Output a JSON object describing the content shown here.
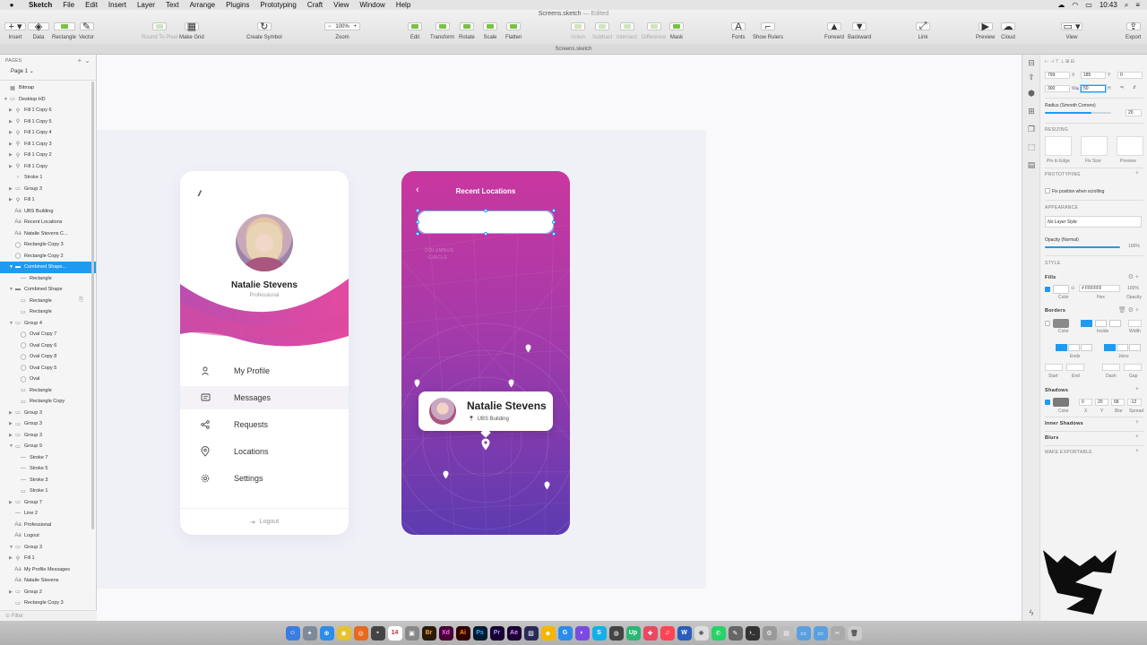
{
  "menubar": {
    "items": [
      "Sketch",
      "File",
      "Edit",
      "Insert",
      "Layer",
      "Text",
      "Arrange",
      "Plugins",
      "Prototyping",
      "Craft",
      "View",
      "Window",
      "Help"
    ],
    "time": "10:43"
  },
  "toolbar": {
    "doc_title": "Screens.sketch",
    "doc_state": "— Edited",
    "zoom_value": "100%",
    "buttons": {
      "insert": "Insert",
      "data": "Data",
      "rectangle": "Rectangle",
      "vector": "Vector",
      "round": "Round To Pixel",
      "make_grid": "Make Grid",
      "create_symbol": "Create Symbol",
      "zoom": "Zoom",
      "edit": "Edit",
      "transform": "Transform",
      "rotate": "Rotate",
      "scale": "Scale",
      "flatten": "Flatten",
      "union": "Union",
      "subtract": "Subtract",
      "intersect": "Intersect",
      "difference": "Difference",
      "mask": "Mask",
      "fonts": "Fonts",
      "show_rulers": "Show Rulers",
      "forward": "Forward",
      "backward": "Backward",
      "link": "Link",
      "preview": "Preview",
      "cloud": "Cloud",
      "view": "View",
      "export": "Export"
    }
  },
  "tab_title": "Screens.sketch",
  "layers": {
    "pages_header": "PAGES",
    "page": "Page 1",
    "filter": "Filter",
    "rows": [
      {
        "label": "Bitmap",
        "indent": 0,
        "icon": "▦",
        "tri": ""
      },
      {
        "label": "Desktop HD",
        "indent": 0,
        "icon": "▭",
        "tri": "▼"
      },
      {
        "label": "Fill 1 Copy 6",
        "indent": 1,
        "icon": "⚲",
        "tri": "▶"
      },
      {
        "label": "Fill 1 Copy 5",
        "indent": 1,
        "icon": "⚲",
        "tri": "▶"
      },
      {
        "label": "Fill 1 Copy 4",
        "indent": 1,
        "icon": "⚲",
        "tri": "▶"
      },
      {
        "label": "Fill 1 Copy 3",
        "indent": 1,
        "icon": "⚲",
        "tri": "▶"
      },
      {
        "label": "Fill 1 Copy 2",
        "indent": 1,
        "icon": "⚲",
        "tri": "▶"
      },
      {
        "label": "Fill 1 Copy",
        "indent": 1,
        "icon": "⚲",
        "tri": "▶"
      },
      {
        "label": "Stroke 1",
        "indent": 1,
        "icon": "‹",
        "tri": ""
      },
      {
        "label": "Group 3",
        "indent": 1,
        "icon": "▭",
        "tri": "▶"
      },
      {
        "label": "Fill 1",
        "indent": 1,
        "icon": "⚲",
        "tri": "▶"
      },
      {
        "label": "UBS Building",
        "indent": 1,
        "icon": "Aa",
        "tri": ""
      },
      {
        "label": "Recent Locations",
        "indent": 1,
        "icon": "Aa",
        "tri": ""
      },
      {
        "label": "Natalie Stevens C...",
        "indent": 1,
        "icon": "Aa",
        "tri": ""
      },
      {
        "label": "Rectangle Copy 3",
        "indent": 1,
        "icon": "◯",
        "tri": ""
      },
      {
        "label": "Rectangle Copy 2",
        "indent": 1,
        "icon": "◯",
        "tri": ""
      },
      {
        "label": "Combined Shape...",
        "indent": 1,
        "icon": "▬",
        "tri": "▼",
        "selected": true
      },
      {
        "label": "Rectangle",
        "indent": 2,
        "icon": "—",
        "tri": ""
      },
      {
        "label": "Combined Shape",
        "indent": 1,
        "icon": "▬",
        "tri": "▼"
      },
      {
        "label": "Rectangle",
        "indent": 2,
        "icon": "▭",
        "tri": "",
        "lock": true
      },
      {
        "label": "Rectangle",
        "indent": 2,
        "icon": "▭",
        "tri": ""
      },
      {
        "label": "Group 4",
        "indent": 1,
        "icon": "▭",
        "tri": "▼"
      },
      {
        "label": "Oval Copy 7",
        "indent": 2,
        "icon": "◯",
        "tri": ""
      },
      {
        "label": "Oval Copy 6",
        "indent": 2,
        "icon": "◯",
        "tri": ""
      },
      {
        "label": "Oval Copy 8",
        "indent": 2,
        "icon": "◯",
        "tri": ""
      },
      {
        "label": "Oval Copy 5",
        "indent": 2,
        "icon": "◯",
        "tri": ""
      },
      {
        "label": "Oval",
        "indent": 2,
        "icon": "◯",
        "tri": ""
      },
      {
        "label": "Rectangle",
        "indent": 2,
        "icon": "▭",
        "tri": ""
      },
      {
        "label": "Rectangle Copy",
        "indent": 2,
        "icon": "▭",
        "tri": ""
      },
      {
        "label": "Group 3",
        "indent": 1,
        "icon": "▭",
        "tri": "▶"
      },
      {
        "label": "Group 3",
        "indent": 1,
        "icon": "▭",
        "tri": "▶"
      },
      {
        "label": "Group 3",
        "indent": 1,
        "icon": "▭",
        "tri": "▶"
      },
      {
        "label": "Group 9",
        "indent": 1,
        "icon": "▭",
        "tri": "▼"
      },
      {
        "label": "Stroke 7",
        "indent": 2,
        "icon": "—",
        "tri": ""
      },
      {
        "label": "Stroke 5",
        "indent": 2,
        "icon": "—",
        "tri": ""
      },
      {
        "label": "Stroke 3",
        "indent": 2,
        "icon": "—",
        "tri": ""
      },
      {
        "label": "Stroke 1",
        "indent": 2,
        "icon": "▭",
        "tri": ""
      },
      {
        "label": "Group 7",
        "indent": 1,
        "icon": "▭",
        "tri": "▶"
      },
      {
        "label": "Line 2",
        "indent": 1,
        "icon": "—",
        "tri": ""
      },
      {
        "label": "Professional",
        "indent": 1,
        "icon": "Aa",
        "tri": ""
      },
      {
        "label": "Logout",
        "indent": 1,
        "icon": "Aa",
        "tri": ""
      },
      {
        "label": "Group 3",
        "indent": 1,
        "icon": "▭",
        "tri": "▼"
      },
      {
        "label": "Fill 1",
        "indent": 1,
        "icon": "⚲",
        "tri": "▶"
      },
      {
        "label": "My Profile Messages",
        "indent": 1,
        "icon": "Aa",
        "tri": ""
      },
      {
        "label": "Natalie Stevens",
        "indent": 1,
        "icon": "Aa",
        "tri": ""
      },
      {
        "label": "Group 2",
        "indent": 1,
        "icon": "▭",
        "tri": "▶"
      },
      {
        "label": "Rectangle Copy 3",
        "indent": 1,
        "icon": "▭",
        "tri": ""
      }
    ]
  },
  "menu_card": {
    "name": "Natalie Stevens",
    "role": "Professional",
    "items": [
      {
        "label": "My Profile",
        "icon": "user-icon"
      },
      {
        "label": "Messages",
        "icon": "message-icon",
        "active": true
      },
      {
        "label": "Requests",
        "icon": "share-icon"
      },
      {
        "label": "Locations",
        "icon": "location-pin-icon"
      },
      {
        "label": "Settings",
        "icon": "gear-icon"
      }
    ],
    "logout": "Logout"
  },
  "map_card": {
    "title": "Recent Locations",
    "map_labels": [
      "COLUMBUS",
      "CIRCLE"
    ],
    "person_name": "Natalie Stevens",
    "person_location": "UBS Building"
  },
  "inspector": {
    "x": "799",
    "y": "185",
    "rotation": "0",
    "width": "300",
    "height": "50",
    "x_label": "X",
    "y_label": "Y",
    "w_label": "W",
    "h_label": "H",
    "radius_label": "Radius (Smooth Corners)",
    "radius_value": "20",
    "resizing": "RESIZING",
    "resize_options": [
      "Pin to Edge",
      "Fix Size",
      "Preview"
    ],
    "prototyping": "PROTOTYPING",
    "fix_position": "Fix position when scrolling",
    "appearance": "APPEARANCE",
    "layer_style": "No Layer Style",
    "opacity_label": "Opacity (Normal)",
    "opacity_value": "100%",
    "style": "STYLE",
    "fills": "Fills",
    "fill_hex": "# FFFFFF",
    "fill_opacity": "100%",
    "fill_sub": [
      "Color",
      "Hex",
      "Opacity"
    ],
    "borders": "Borders",
    "border_sub": [
      "Color",
      "Inside",
      "Width"
    ],
    "ends_joins": [
      "Ends",
      "Joins"
    ],
    "dash_labels": [
      "Start",
      "End",
      "Dash",
      "Gap"
    ],
    "shadows": "Shadows",
    "shadow_values": [
      "0",
      "20",
      "68",
      "-12"
    ],
    "shadow_sub": [
      "Color",
      "X",
      "Y",
      "Blur",
      "Spread"
    ],
    "inner_shadows": "Inner Shadows",
    "blurs": "Blurs",
    "make_exportable": "MAKE EXPORTABLE"
  },
  "colors": {
    "accent": "#1e9bf0",
    "gradient_top": "#c9379e",
    "gradient_bottom": "#5c3bb0"
  }
}
